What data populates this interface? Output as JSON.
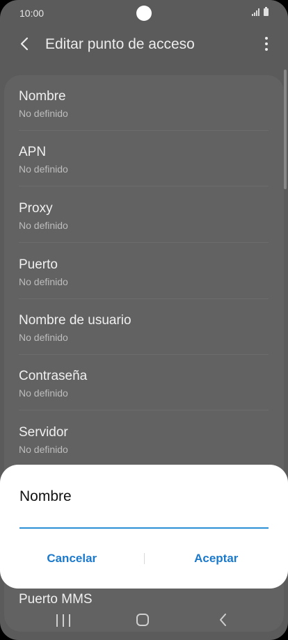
{
  "status_bar": {
    "time": "10:00",
    "icons": [
      "signal-icon",
      "battery-icon"
    ]
  },
  "app_bar": {
    "title": "Editar punto de acceso",
    "back_icon": "back-arrow-icon",
    "more_icon": "more-options-icon"
  },
  "list": {
    "items": [
      {
        "title": "Nombre",
        "subtitle": "No definido"
      },
      {
        "title": "APN",
        "subtitle": "No definido"
      },
      {
        "title": "Proxy",
        "subtitle": "No definido"
      },
      {
        "title": "Puerto",
        "subtitle": "No definido"
      },
      {
        "title": "Nombre de usuario",
        "subtitle": "No definido"
      },
      {
        "title": "Contraseña",
        "subtitle": "No definido"
      },
      {
        "title": "Servidor",
        "subtitle": "No definido"
      },
      {
        "title": "Puerto MMS"
      }
    ]
  },
  "dialog": {
    "title": "Nombre",
    "input_value": "",
    "cancel_label": "Cancelar",
    "accept_label": "Aceptar"
  },
  "nav_bar": {
    "icons": [
      "recent-apps-icon",
      "home-icon",
      "back-icon"
    ]
  },
  "colors": {
    "accent": "#1b79cc",
    "input_underline": "#2b8fd6",
    "scrim_background": "#5b5b5b",
    "dialog_background": "#ffffff"
  }
}
